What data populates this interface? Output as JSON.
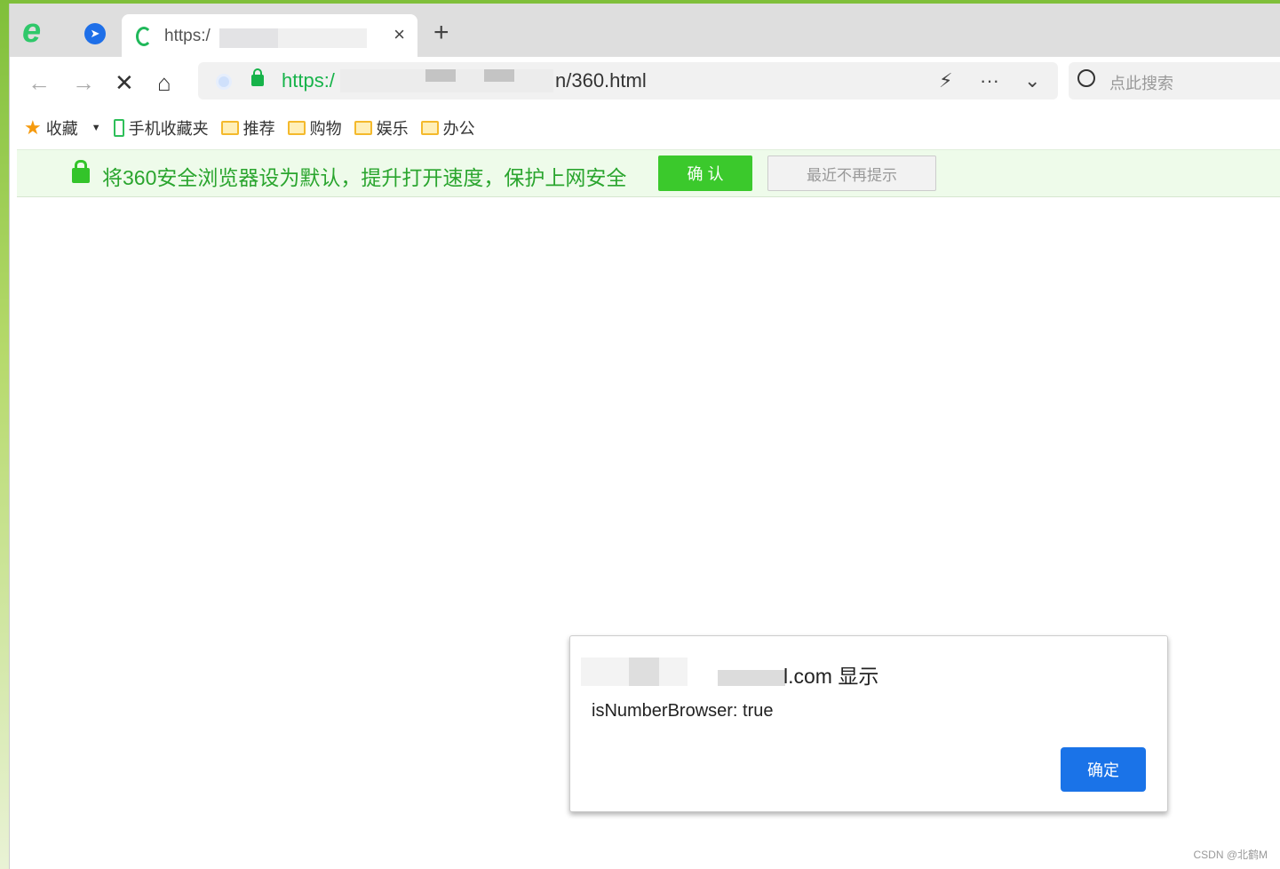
{
  "browser": {
    "tab_title": "https:/",
    "new_tab": "+",
    "close_tab": "×"
  },
  "address": {
    "url_prefix": "https:/",
    "url_suffix": "n/360.html",
    "search_placeholder": "点此搜索"
  },
  "bookmarks": [
    {
      "label": "收藏",
      "icon": "star-icon"
    },
    {
      "label": "手机收藏夹",
      "icon": "phone-icon"
    },
    {
      "label": "推荐",
      "icon": "folder-icon"
    },
    {
      "label": "购物",
      "icon": "folder-icon"
    },
    {
      "label": "娱乐",
      "icon": "folder-icon"
    },
    {
      "label": "办公",
      "icon": "folder-icon"
    }
  ],
  "notice": {
    "message": "将360安全浏览器设为默认，提升打开速度，保护上网安全",
    "confirm": "确 认",
    "dismiss": "最近不再提示"
  },
  "dialog": {
    "title": "l.com 显示",
    "message": "isNumberBrowser: true",
    "ok": "确定"
  },
  "watermark": "CSDN @北鹤M",
  "colors": {
    "accent_green": "#17b34a",
    "dialog_button": "#1a73e8",
    "notice_bg": "#eefbea"
  }
}
